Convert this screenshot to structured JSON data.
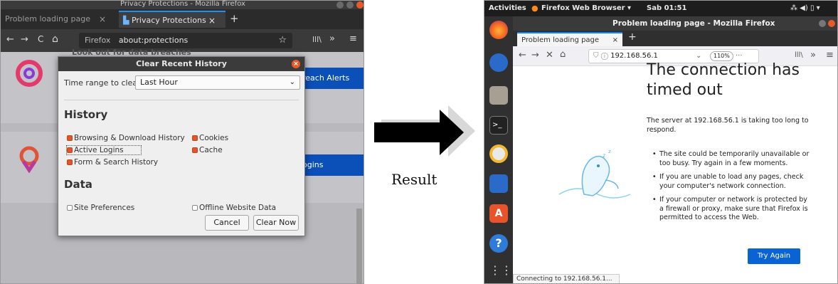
{
  "left": {
    "window_title": "Privacy Protections - Mozilla Firefox",
    "tabs": [
      {
        "label": "Problem loading page",
        "close": "×"
      },
      {
        "label": "Privacy Protections",
        "close": "×"
      }
    ],
    "new_tab": "+",
    "nav": {
      "back": "←",
      "forward": "→",
      "reload": "C",
      "home": "⌂",
      "identity": "Firefox",
      "url": "about:protections",
      "star": "☆",
      "library": "lll\\",
      "overflow": "»",
      "menu": "≡"
    },
    "bg_heading_fragment": "Look out for data breaches",
    "bg_button1": "reach Alerts",
    "bg_button2": "ogins",
    "dialog": {
      "title": "Clear Recent History",
      "close": "×",
      "time_range_label": "Time range to clear:",
      "time_range_value": "Last Hour",
      "history_heading": "History",
      "history_items": [
        {
          "label": "Browsing & Download History",
          "checked": true
        },
        {
          "label": "Cookies",
          "checked": true
        },
        {
          "label": "Active Logins",
          "checked": true
        },
        {
          "label": "Cache",
          "checked": true
        },
        {
          "label": "Form & Search History",
          "checked": true
        }
      ],
      "data_heading": "Data",
      "data_items": [
        {
          "label": "Site Preferences",
          "checked": false
        },
        {
          "label": "Offline Website Data",
          "checked": false
        }
      ],
      "cancel": "Cancel",
      "clear_now": "Clear Now"
    }
  },
  "middle": {
    "result_label": "Result"
  },
  "right": {
    "topbar": {
      "activities": "Activities",
      "app": "Firefox Web Browser ▾",
      "clock": "Sab 01:51",
      "indicators": "⁂ ◀) ▯ ▾"
    },
    "window_title": "Problem loading page - Mozilla Firefox",
    "tab_label": "Problem loading page",
    "tab_close": "×",
    "new_tab": "+",
    "nav": {
      "back": "←",
      "forward": "→",
      "stop": "✕",
      "home": "⌂",
      "url": "192.168.56.1",
      "zoom": "110%",
      "more": "···",
      "library": "lll\\",
      "overflow": "»",
      "menu": "≡"
    },
    "heading": "The connection has timed out",
    "server_text": "The server at 192.168.56.1 is taking too long to respond.",
    "bullets": [
      "The site could be temporarily unavailable or too busy. Try again in a few moments.",
      "If you are unable to load any pages, check your computer's network connection.",
      "If your computer or network is protected by a firewall or proxy, make sure that Firefox is permitted to access the Web."
    ],
    "try_again": "Try Again",
    "status": "Connecting to 192.168.56.1..."
  },
  "colors": {
    "accent_blue": "#0a63d4",
    "checkbox_orange": "#e2552a",
    "dark_chrome": "#2b2b2b"
  }
}
